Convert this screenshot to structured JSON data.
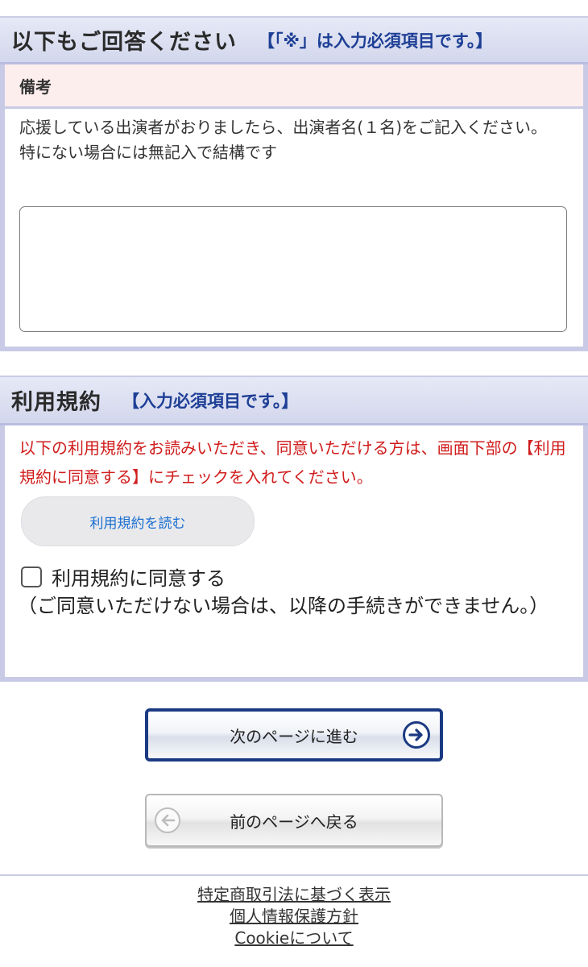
{
  "survey_section": {
    "title": "以下もご回答ください",
    "required_note": "【「※」は入力必須項目です。】"
  },
  "remarks": {
    "label": "備考",
    "description_line1": "応援している出演者がおりましたら、出演者名(１名)をご記入ください。",
    "description_line2": "特にない場合には無記入で結構です",
    "value": "",
    "placeholder": ""
  },
  "terms_section": {
    "title": "利用規約",
    "required_note": "【入力必須項目です。】",
    "warning": "以下の利用規約をお読みいただき、同意いただける方は、画面下部の【利用規約に同意する】にチェックを入れてください。",
    "read_button": "利用規約を読む",
    "agree_label": "利用規約に同意する",
    "agree_note": "（ご同意いただけない場合は、以降の手続きができません。）",
    "agree_checked": false
  },
  "navigation": {
    "next_label": "次のページに進む",
    "prev_label": "前のページへ戻る"
  },
  "footer": {
    "link_1": "特定商取引法に基づく表示",
    "link_2": "個人情報保護方針",
    "link_3": "Cookieについて"
  },
  "colors": {
    "accent_blue": "#1b3a82",
    "warning_red": "#d01d1d",
    "link_blue": "#1a6fd1"
  }
}
